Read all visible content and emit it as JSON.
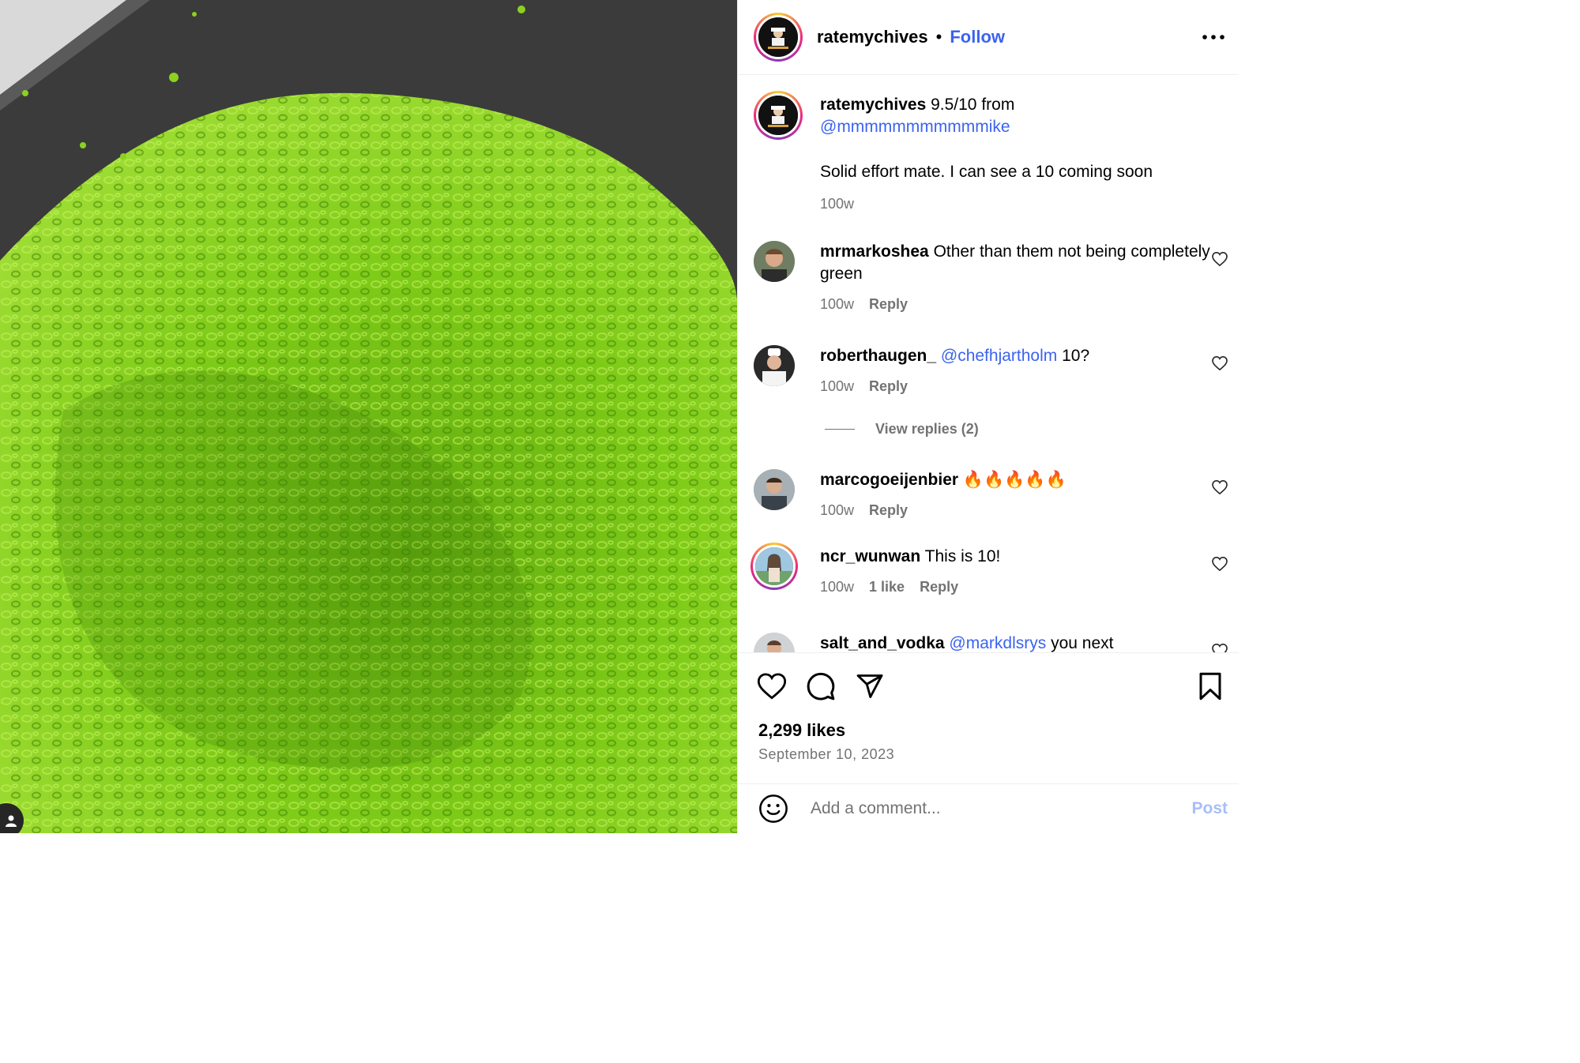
{
  "colors": {
    "link": "#3b63f0",
    "muted": "#737373",
    "chive_green": "#7fc91c",
    "board": "#3a3a3a"
  },
  "media": {
    "tag_icon": "user-tag-icon"
  },
  "header": {
    "username": "ratemychives",
    "separator": "•",
    "follow_label": "Follow",
    "more_icon": "more-horizontal-icon"
  },
  "caption": {
    "username": "ratemychives",
    "text_line1": " 9.5/10 from",
    "mention": "@mmmmmmmmmmmike",
    "text_line2": "Solid effort mate. I can see a 10 coming soon",
    "time": "100w"
  },
  "comments": [
    {
      "username": "mrmarkoshea",
      "text": " Other than them not being completely green",
      "time": "100w",
      "reply": "Reply"
    },
    {
      "username": "roberthaugen_",
      "mention": "@chefhjartholm",
      "text": " 10?",
      "time": "100w",
      "reply": "Reply"
    },
    {
      "username": "marcogoeijenbier",
      "text": " 🔥🔥🔥🔥🔥",
      "time": "100w",
      "reply": "Reply"
    },
    {
      "username": "ncr_wunwan",
      "text": " This is 10!",
      "time": "100w",
      "likes": "1 like",
      "reply": "Reply"
    },
    {
      "username": "salt_and_vodka",
      "mention": "@markdlsrys",
      "text": " you next"
    }
  ],
  "view_replies": "View replies (2)",
  "actions": {
    "like_icon": "heart-icon",
    "comment_icon": "comment-icon",
    "share_icon": "paper-plane-icon",
    "save_icon": "bookmark-icon"
  },
  "likes": "2,299 likes",
  "date": "September 10, 2023",
  "add_comment": {
    "placeholder": "Add a comment...",
    "post_label": "Post",
    "emoji_icon": "emoji-icon"
  }
}
